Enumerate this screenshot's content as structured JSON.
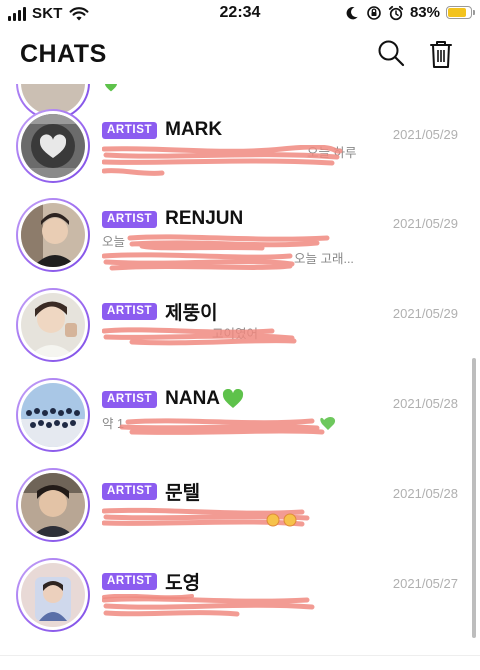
{
  "status_bar": {
    "carrier": "SKT",
    "time": "22:34",
    "battery_percent": "83%",
    "battery_level": 0.83,
    "icons": [
      "signal-icon",
      "wifi-icon",
      "moon-icon",
      "orientation-lock-icon",
      "alarm-icon",
      "battery-icon"
    ]
  },
  "header": {
    "title": "CHATS",
    "actions": [
      "search-icon",
      "trash-icon"
    ]
  },
  "colors": {
    "accent": "#8c5cf0",
    "redaction": "#f08a80",
    "date": "#b0b0b0",
    "heart": "#5ec24b"
  },
  "chats": [
    {
      "badge": "ARTIST",
      "name": "MARK",
      "date": "2021/05/29",
      "preview": "오늘 하루",
      "preview2": ""
    },
    {
      "badge": "ARTIST",
      "name": "RENJUN",
      "date": "2021/05/29",
      "preview": "오늘",
      "preview2": "오늘 고래..."
    },
    {
      "badge": "ARTIST",
      "name": "제뚱이",
      "date": "2021/05/29",
      "preview": "고이였어",
      "preview2": ""
    },
    {
      "badge": "ARTIST",
      "name": "NANA",
      "name_suffix_icon": "green-heart-icon",
      "date": "2021/05/28",
      "preview": "약 1",
      "preview2": ""
    },
    {
      "badge": "ARTIST",
      "name": "문텔",
      "date": "2021/05/28",
      "preview": "",
      "preview2": ""
    },
    {
      "badge": "ARTIST",
      "name": "도영",
      "date": "2021/05/27",
      "preview": "",
      "preview2": ""
    }
  ]
}
